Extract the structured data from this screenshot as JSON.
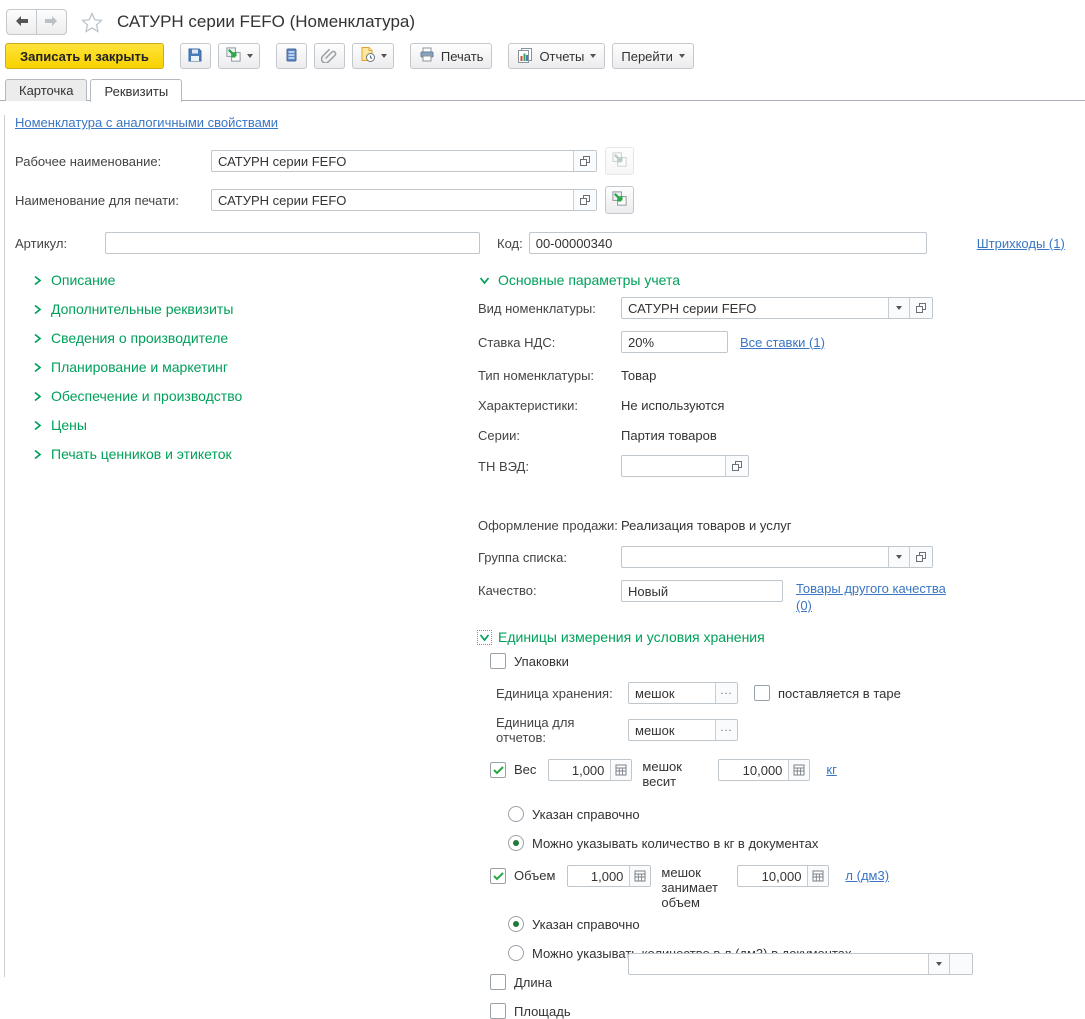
{
  "header": {
    "title": "САТУРН серии FEFO (Номенклатура)"
  },
  "toolbar": {
    "save_close": "Записать и закрыть",
    "print": "Печать",
    "reports": "Отчеты",
    "goto": "Перейти"
  },
  "tabs": [
    {
      "label": "Карточка"
    },
    {
      "label": "Реквизиты"
    }
  ],
  "links": {
    "similar": "Номенклатура с аналогичными свойствами",
    "barcodes": "Штрихкоды (1)",
    "all_rates": "Все ставки (1)",
    "other_quality": "Товары другого качества (0)",
    "kg": "кг",
    "liters": "л (дм3)"
  },
  "fields": {
    "working_name": {
      "label": "Рабочее наименование:",
      "value": "САТУРН серии FEFO"
    },
    "print_name": {
      "label": "Наименование для печати:",
      "value": "САТУРН серии FEFO"
    },
    "article": {
      "label": "Артикул:",
      "value": ""
    },
    "code": {
      "label": "Код:",
      "value": "00-00000340"
    }
  },
  "left_sections": [
    {
      "label": "Описание"
    },
    {
      "label": "Дополнительные реквизиты"
    },
    {
      "label": "Сведения о производителе"
    },
    {
      "label": "Планирование и маркетинг"
    },
    {
      "label": "Обеспечение и производство"
    },
    {
      "label": "Цены"
    },
    {
      "label": "Печать ценников и этикеток"
    }
  ],
  "main_params": {
    "title": "Основные параметры учета",
    "vid": {
      "label": "Вид номенклатуры:",
      "value": "САТУРН серии FEFO"
    },
    "vat": {
      "label": "Ставка НДС:",
      "value": "20%"
    },
    "type": {
      "label": "Тип номенклатуры:",
      "value": "Товар"
    },
    "characteristics": {
      "label": "Характеристики:",
      "value": "Не используются"
    },
    "series": {
      "label": "Серии:",
      "value": "Партия товаров"
    },
    "tnved": {
      "label": "ТН ВЭД:",
      "value": ""
    },
    "sale": {
      "label": "Оформление продажи:",
      "value": "Реализация товаров и услуг"
    },
    "list_group": {
      "label": "Группа списка:",
      "value": ""
    },
    "quality": {
      "label": "Качество:",
      "value": "Новый"
    }
  },
  "units": {
    "title": "Единицы измерения и условия хранения",
    "packages_label": "Упаковки",
    "storage_unit": {
      "label": "Единица хранения:",
      "value": "мешок"
    },
    "in_tare_label": "поставляется в таре",
    "report_unit": {
      "label": "Единица для отчетов:",
      "value": "мешок"
    },
    "weight": {
      "label": "Вес",
      "value1": "1,000",
      "mid": "мешок весит",
      "value2": "10,000",
      "radio_ref": "Указан справочно",
      "radio_doc": "Можно указывать количество в кг в документах",
      "selected": "doc"
    },
    "volume": {
      "label": "Объем",
      "value1": "1,000",
      "mid": "мешок занимает объем",
      "value2": "10,000",
      "radio_ref": "Указан справочно",
      "radio_doc": "Можно указывать количество в л (дм3) в документах",
      "selected": "ref"
    },
    "length_label": "Длина",
    "area_label": "Площадь"
  },
  "colors": {
    "accent_green": "#00a05a",
    "link_blue": "#3a76c4",
    "button_yellow": "#f8d200"
  }
}
